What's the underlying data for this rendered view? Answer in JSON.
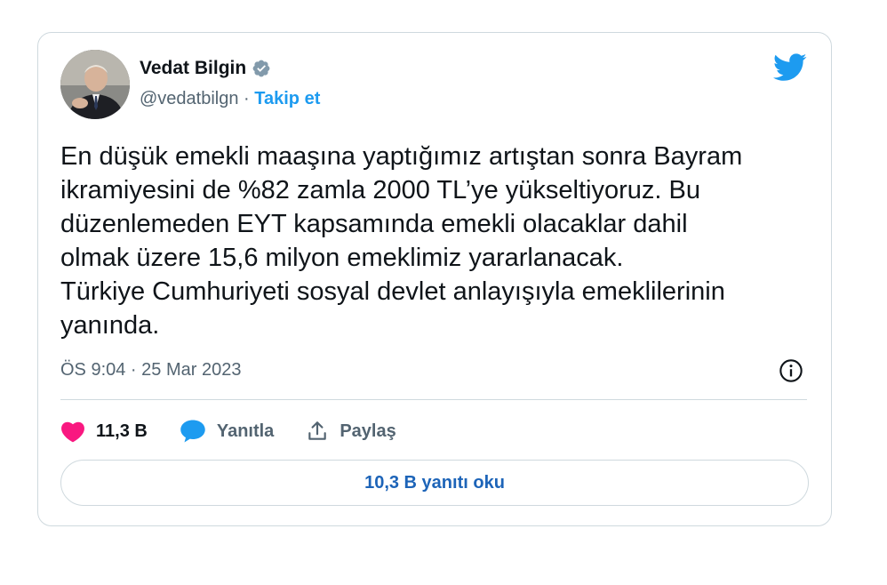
{
  "author": {
    "name": "Vedat Bilgin",
    "handle": "@vedatbilgn",
    "separator": " · ",
    "follow_label": "Takip et",
    "verified": true
  },
  "tweet": {
    "text": "En düşük emekli maaşına yaptığımız artıştan sonra Bayram\nikramiyesini de %82 zamla 2000 TL’ye yükseltiyoruz. Bu\ndüzenlemeden EYT kapsamında emekli olacaklar dahil\nolmak üzere 15,6 milyon emeklimiz yararlanacak.\nTürkiye Cumhuriyeti sosyal devlet anlayışıyla emeklilerinin\nyanında.",
    "timestamp": "ÖS 9:04 · 25 Mar 2023"
  },
  "actions": {
    "like_count": "11,3 B",
    "reply_label": "Yanıtla",
    "share_label": "Paylaş"
  },
  "read_replies_label": "10,3 B yanıtı oku",
  "icons": {
    "brand": "twitter-bird-icon",
    "verified": "verified-badge-icon",
    "info": "info-icon",
    "like": "heart-icon",
    "reply": "speech-bubble-icon",
    "share": "share-upload-icon"
  },
  "colors": {
    "brand_blue": "#1d9bf0",
    "like_pink": "#f91880",
    "text_secondary": "#536471",
    "border": "#cfd9de",
    "verified_gray": "#829aab"
  }
}
